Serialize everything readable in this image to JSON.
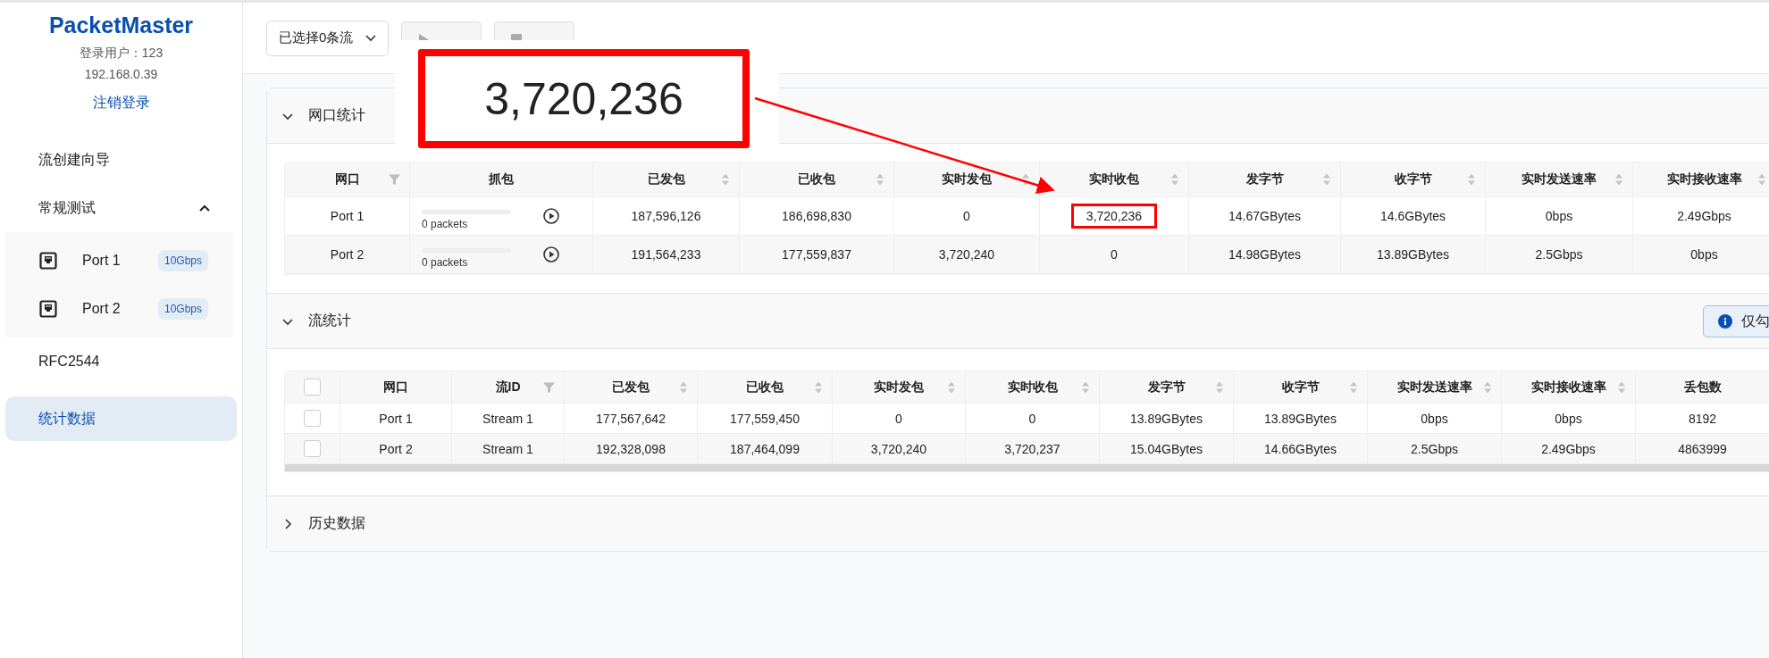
{
  "sidebar": {
    "brand": "PacketMaster",
    "user": "登录用户：123",
    "ip": "192.168.0.39",
    "logout": "注销登录",
    "items": [
      {
        "kind": "link",
        "label": "流创建向导",
        "selected": false
      },
      {
        "kind": "group",
        "label": "常规测试",
        "selected": false,
        "expanded": true,
        "children": [
          {
            "label": "Port 1",
            "badge": "10Gbps",
            "selected": false
          },
          {
            "label": "Port 2",
            "badge": "10Gbps",
            "selected": false
          }
        ]
      },
      {
        "kind": "link",
        "label": "RFC2544",
        "selected": false
      },
      {
        "kind": "link",
        "label": "统计数据",
        "selected": true
      }
    ]
  },
  "toolbar": {
    "stream_select": "已选择0条流",
    "buttons": [
      {
        "kind": "start",
        "disabled": true
      },
      {
        "kind": "stop",
        "disabled": true
      }
    ]
  },
  "panels": [
    {
      "kind": "ports",
      "title": "网口统计",
      "expanded": true,
      "columns": [
        {
          "label": "网口",
          "sortable": false,
          "filterable": true
        },
        {
          "label": "抓包",
          "sortable": false,
          "filterable": false
        },
        {
          "label": "已发包",
          "sortable": true,
          "filterable": false
        },
        {
          "label": "已收包",
          "sortable": true,
          "filterable": false
        },
        {
          "label": "实时发包",
          "sortable": true,
          "filterable": false
        },
        {
          "label": "实时收包",
          "sortable": true,
          "filterable": false
        },
        {
          "label": "发字节",
          "sortable": true,
          "filterable": false
        },
        {
          "label": "收字节",
          "sortable": true,
          "filterable": false
        },
        {
          "label": "实时发送速率",
          "sortable": true,
          "filterable": false
        },
        {
          "label": "实时接收速率",
          "sortable": true,
          "filterable": false
        }
      ],
      "rows": [
        {
          "port": "Port 1",
          "capture": {
            "packets": "0 packets",
            "level": 0
          },
          "values": [
            {
              "text": "187,596,126",
              "highlighted": false
            },
            {
              "text": "186,698,830",
              "highlighted": false
            },
            {
              "text": "0",
              "highlighted": false
            },
            {
              "text": "3,720,236",
              "highlighted": true
            },
            {
              "text": "14.67GBytes",
              "highlighted": false
            },
            {
              "text": "14.6GBytes",
              "highlighted": false
            },
            {
              "text": "0bps",
              "highlighted": false
            },
            {
              "text": "2.49Gbps",
              "highlighted": false
            }
          ]
        },
        {
          "port": "Port 2",
          "capture": {
            "packets": "0 packets",
            "level": 0
          },
          "values": [
            {
              "text": "191,564,233",
              "highlighted": false
            },
            {
              "text": "177,559,837",
              "highlighted": false
            },
            {
              "text": "3,720,240",
              "highlighted": false
            },
            {
              "text": "0",
              "highlighted": false
            },
            {
              "text": "14.98GBytes",
              "highlighted": false
            },
            {
              "text": "13.89GBytes",
              "highlighted": false
            },
            {
              "text": "2.5Gbps",
              "highlighted": false
            },
            {
              "text": "0bps",
              "highlighted": false
            }
          ]
        }
      ]
    },
    {
      "kind": "streams",
      "title": "流统计",
      "expanded": true,
      "notice_button": "仅勾",
      "header_checked": false,
      "columns": [
        {
          "label": "网口",
          "sortable": false,
          "filterable": false
        },
        {
          "label": "流ID",
          "sortable": false,
          "filterable": true
        },
        {
          "label": "已发包",
          "sortable": true,
          "filterable": false
        },
        {
          "label": "已收包",
          "sortable": true,
          "filterable": false
        },
        {
          "label": "实时发包",
          "sortable": true,
          "filterable": false
        },
        {
          "label": "实时收包",
          "sortable": true,
          "filterable": false
        },
        {
          "label": "发字节",
          "sortable": true,
          "filterable": false
        },
        {
          "label": "收字节",
          "sortable": true,
          "filterable": false
        },
        {
          "label": "实时发送速率",
          "sortable": true,
          "filterable": false
        },
        {
          "label": "实时接收速率",
          "sortable": true,
          "filterable": false
        },
        {
          "label": "丢包数",
          "sortable": false,
          "filterable": false
        }
      ],
      "rows": [
        {
          "checked": false,
          "cells": [
            "Port 1",
            "Stream 1",
            "177,567,642",
            "177,559,450",
            "0",
            "0",
            "13.89GBytes",
            "13.89GBytes",
            "0bps",
            "0bps",
            "8192"
          ]
        },
        {
          "checked": false,
          "cells": [
            "Port 2",
            "Stream 1",
            "192,328,098",
            "187,464,099",
            "3,720,240",
            "3,720,237",
            "15.04GBytes",
            "14.66GBytes",
            "2.5Gbps",
            "2.49Gbps",
            "4863999"
          ]
        }
      ]
    },
    {
      "kind": "history",
      "title": "历史数据",
      "expanded": false
    }
  ],
  "zoom_callout": {
    "text": "3,720,236"
  }
}
